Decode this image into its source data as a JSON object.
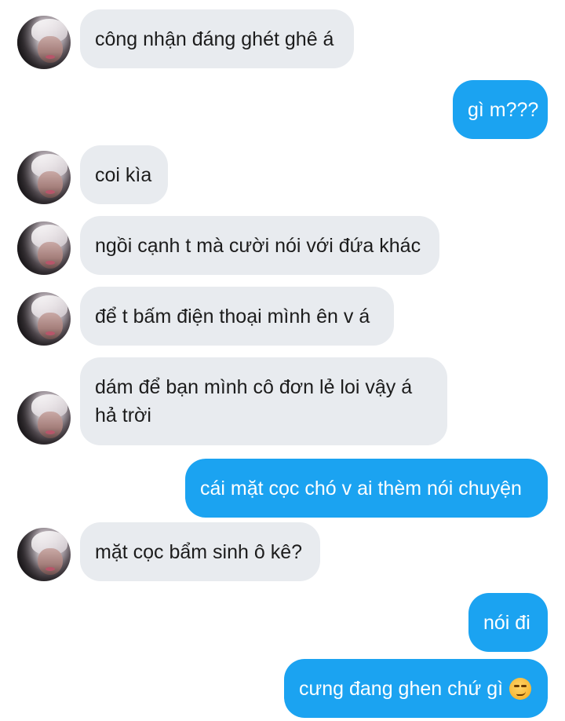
{
  "conversation": {
    "messages": [
      {
        "direction": "in",
        "text": "công nhận đáng ghét ghê á"
      },
      {
        "direction": "out",
        "text": "gì m???"
      },
      {
        "direction": "in",
        "text": "coi kìa"
      },
      {
        "direction": "in",
        "text": "ngồi cạnh t mà cười nói với đứa khác"
      },
      {
        "direction": "in",
        "text": "để t bấm điện thoại mình ên v á"
      },
      {
        "direction": "in",
        "text": "dám để bạn mình cô đơn lẻ loi vậy á hả trời"
      },
      {
        "direction": "out",
        "text": "cái mặt cọc chó v ai thèm nói chuyện"
      },
      {
        "direction": "in",
        "text": "mặt cọc bẩm sinh ô kê?"
      },
      {
        "direction": "out",
        "text": "nói đi"
      },
      {
        "direction": "out",
        "text": "cưng đang ghen chứ gì",
        "emoji": "smirking-face-icon"
      }
    ]
  },
  "colors": {
    "incoming_bubble": "#e8ebef",
    "outgoing_bubble": "#1ba3f1",
    "incoming_text": "#1c1c1c",
    "outgoing_text": "#ffffff",
    "background": "#ffffff"
  }
}
